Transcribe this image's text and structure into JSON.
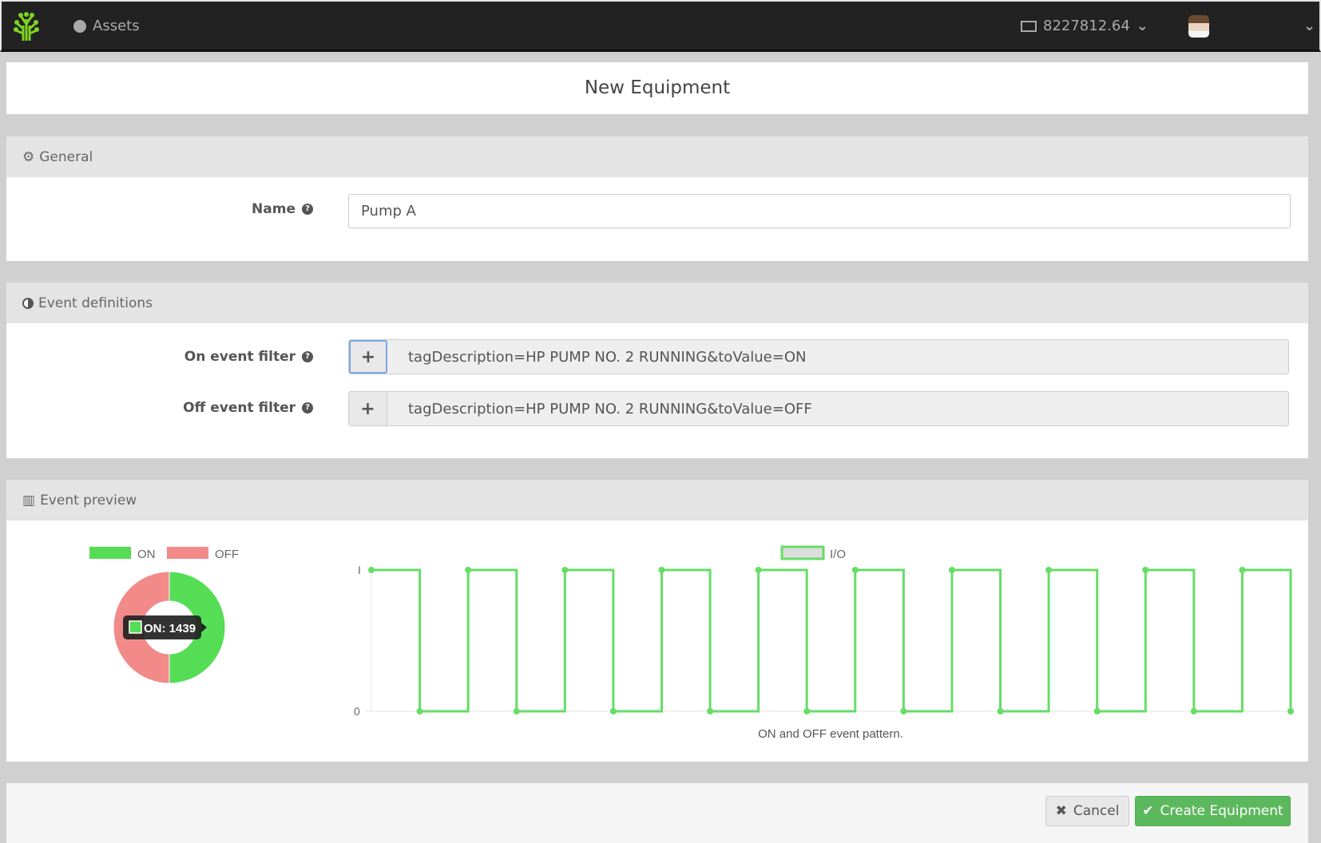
{
  "nav": {
    "assets": "Assets",
    "balance": "8227812.64"
  },
  "page": {
    "title": "New Equipment"
  },
  "general": {
    "header": "General",
    "name_label": "Name",
    "name_value": "Pump A"
  },
  "events": {
    "header": "Event definitions",
    "on_label": "On event filter",
    "on_value": "tagDescription=HP PUMP NO. 2 RUNNING&toValue=ON",
    "off_label": "Off event filter",
    "off_value": "tagDescription=HP PUMP NO. 2 RUNNING&toValue=OFF",
    "add": "+"
  },
  "preview": {
    "header": "Event preview"
  },
  "chart_data": [
    {
      "type": "pie",
      "variant": "doughnut",
      "legend": [
        "ON",
        "OFF"
      ],
      "colors": [
        "#55dd55",
        "#f28a8a"
      ],
      "values": [
        1439,
        1439
      ],
      "tooltip": "ON: 1439"
    },
    {
      "type": "line",
      "stepped": true,
      "legend": "I/O",
      "caption": "ON and OFF event pattern.",
      "y_ticks": [
        "0",
        "I"
      ],
      "ylim": [
        0,
        1
      ],
      "values": [
        1,
        0,
        1,
        0,
        1,
        0,
        1,
        0,
        1,
        0,
        1,
        0,
        1,
        0,
        1,
        0,
        1,
        0,
        1,
        0
      ],
      "color": "#66dd66"
    }
  ],
  "footer": {
    "cancel": "Cancel",
    "create": "Create Equipment"
  }
}
